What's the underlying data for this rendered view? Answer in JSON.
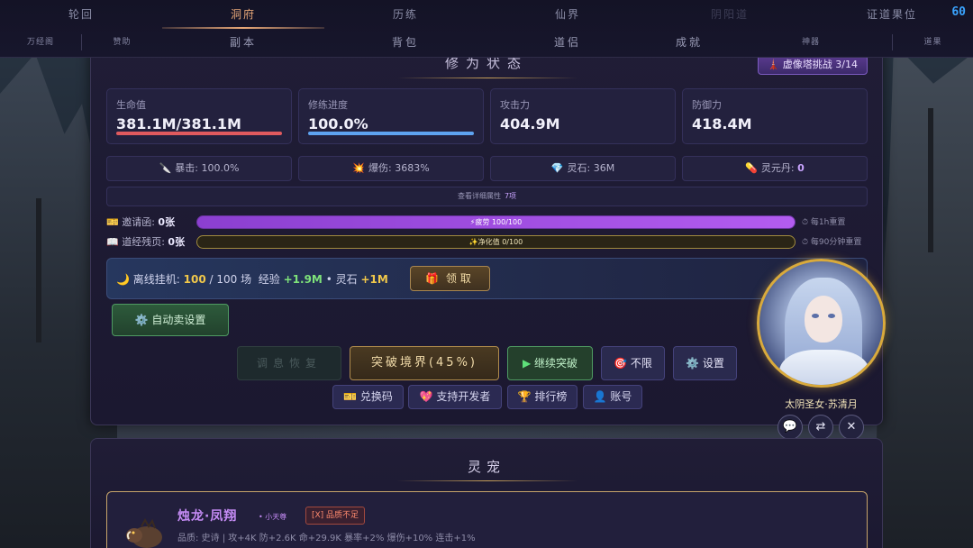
{
  "fps": "60",
  "nav": {
    "tabs": [
      {
        "label": "轮回"
      },
      {
        "label": "洞府"
      },
      {
        "label": "历练"
      },
      {
        "label": "仙界"
      },
      {
        "label": "阴阳道"
      },
      {
        "label": "证道果位"
      }
    ],
    "sub": [
      {
        "label": "万经阁"
      },
      {
        "label": "赞助"
      },
      {
        "label": "副本"
      },
      {
        "label": "背包"
      },
      {
        "label": "道侣"
      },
      {
        "label": "成就"
      },
      {
        "label": "神器"
      },
      {
        "label": "道果"
      }
    ]
  },
  "status": {
    "title": "修为状态",
    "tower_badge": "虚像塔挑战 3/14",
    "cards": [
      {
        "label": "生命值",
        "value": "381.1M/381.1M",
        "bar_color": "#e05a5e",
        "fill": 1.0
      },
      {
        "label": "修练进度",
        "value": "100.0%",
        "bar_color": "#5ea3f0",
        "fill": 1.0
      },
      {
        "label": "攻击力",
        "value": "404.9M"
      },
      {
        "label": "防御力",
        "value": "418.4M"
      }
    ],
    "minis": [
      {
        "icon": "🔪",
        "label": "暴击:",
        "value": "100.0%"
      },
      {
        "icon": "💥",
        "label": "爆伤:",
        "value": "3683%"
      },
      {
        "icon": "💎",
        "label": "灵石:",
        "value": "36M"
      },
      {
        "icon": "💊",
        "label": "灵元丹:",
        "value": "0"
      }
    ],
    "detail_label": "查看详细属性",
    "detail_count": "7项",
    "resources": [
      {
        "icon": "🎫",
        "label": "邀请函:",
        "value": "0张",
        "bar_text": "⚡疲劳 100/100",
        "fill": 1.0,
        "reset": "每1h重置"
      },
      {
        "icon": "📖",
        "label": "道经残页:",
        "value": "0张",
        "bar_text": "✨净化值 0/100",
        "fill": 0.0,
        "reset": "每90分钟重置"
      }
    ],
    "offline": {
      "prefix": "离线挂机:",
      "count": "100",
      "total": "/ 100 场",
      "exp_label": "经验",
      "exp_value": "+1.9M",
      "dot": "•",
      "stone_label": "灵石",
      "stone_value": "+1M",
      "claim": "领取"
    },
    "auto_sell": "自动卖设置",
    "actions": {
      "rest": "调息恢复",
      "breakthrough": "突破境界(45%)",
      "continue": "继续突破",
      "unlimited": "不限",
      "settings": "设置"
    },
    "links": {
      "redeem": "兑换码",
      "support": "支持开发者",
      "ranking": "排行榜",
      "account": "账号"
    }
  },
  "companion": {
    "name": "太阴圣女·苏清月"
  },
  "pets": {
    "title": "灵宠",
    "name": "烛龙·凤翔",
    "rank_dot": "•",
    "rank": "小天尊",
    "warning": "[X] 品质不足",
    "desc": "品质: 史诗 | 攻+4K 防+2.6K 命+29.9K 暴率+2% 爆伤+10% 连击+1%"
  }
}
